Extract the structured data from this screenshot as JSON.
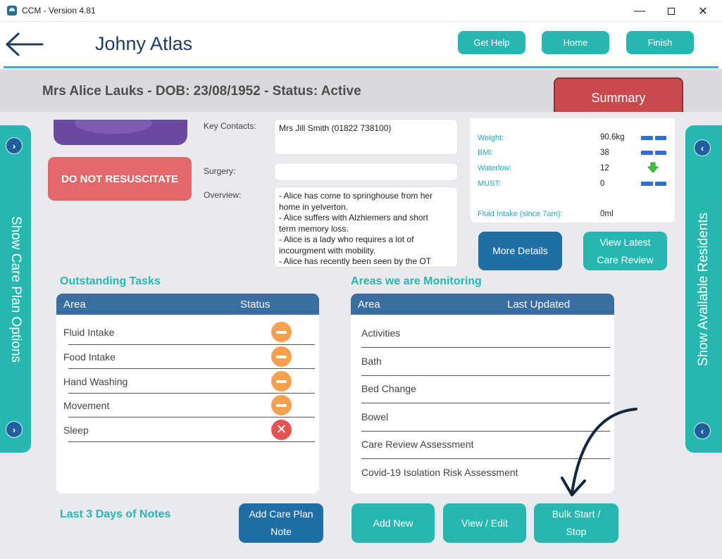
{
  "window": {
    "title": "CCM - Version 4.81"
  },
  "header": {
    "resident_name": "Johny Atlas",
    "buttons": {
      "get_help": "Get Help",
      "home": "Home",
      "finish": "Finish"
    }
  },
  "banner": {
    "text": "Mrs Alice Lauks - DOB: 23/08/1952 - Status: Active",
    "summary_tab": "Summary"
  },
  "side": {
    "left_label": "Show Care Plan Options",
    "right_label": "Show Available Residents"
  },
  "dnr": "DO NOT RESUSCITATE",
  "details": {
    "key_contacts_label": "Key Contacts:",
    "key_contacts_value": "Mrs Jill Smith (01822 738100)",
    "surgery_label": "Surgery:",
    "surgery_value": "",
    "overview_label": "Overview:",
    "overview_lines": [
      "- Alice has come to springhouse from her",
      "home in yelverton.",
      "- Alice suffers with Alzhiemers and short",
      "term memory loss.",
      "- Alice is a lady who requires a lot of",
      "incourgment with mobility.",
      "- Alice has recently been seen by the OT"
    ]
  },
  "metrics": {
    "items": [
      {
        "label": "Weight:",
        "value": "90.6kg",
        "icon": "dash-icon"
      },
      {
        "label": "BMI:",
        "value": "38",
        "icon": "dash-icon"
      },
      {
        "label": "Waterlow:",
        "value": "12",
        "icon": "down-arrow-icon"
      },
      {
        "label": "MUST:",
        "value": "0",
        "icon": "dash-icon"
      }
    ],
    "fluid_label": "Fluid Intake (since 7am):",
    "fluid_value": "0ml",
    "colors": {
      "label": "#1fa9bd",
      "dash": "#2f6fd1",
      "down_arrow": "#3cc43c"
    }
  },
  "buttons": {
    "more_details": "More Details",
    "view_latest_line1": "View Latest",
    "view_latest_line2": "Care Review",
    "add_care_plan_line1": "Add Care Plan",
    "add_care_plan_line2": "Note",
    "add_new": "Add New",
    "view_edit": "View / Edit",
    "bulk_line1": "Bulk Start /",
    "bulk_line2": "Stop"
  },
  "outstanding": {
    "title": "Outstanding Tasks",
    "col_area": "Area",
    "col_status": "Status",
    "rows": [
      {
        "area": "Fluid Intake",
        "status_icon": "minus-circle-icon"
      },
      {
        "area": "Food Intake",
        "status_icon": "minus-circle-icon"
      },
      {
        "area": "Hand Washing",
        "status_icon": "minus-circle-icon"
      },
      {
        "area": "Movement",
        "status_icon": "minus-circle-icon"
      },
      {
        "area": "Sleep",
        "status_icon": "x-circle-icon"
      }
    ]
  },
  "monitoring": {
    "title": "Areas we are Monitoring",
    "col_area": "Area",
    "col_updated": "Last Updated",
    "rows": [
      "Activities",
      "Bath",
      "Bed Change",
      "Bowel",
      "Care Review Assessment",
      "Covid-19 Isolation Risk Assessment"
    ]
  },
  "notes_title": "Last 3 Days of Notes",
  "colors": {
    "teal": "#26b7b0",
    "navy": "#1d3c5e",
    "table_head": "#3a6ea1",
    "summary_red": "#c9494d",
    "dnr_red": "#e4676a",
    "blue_button": "#1f6ea6"
  }
}
